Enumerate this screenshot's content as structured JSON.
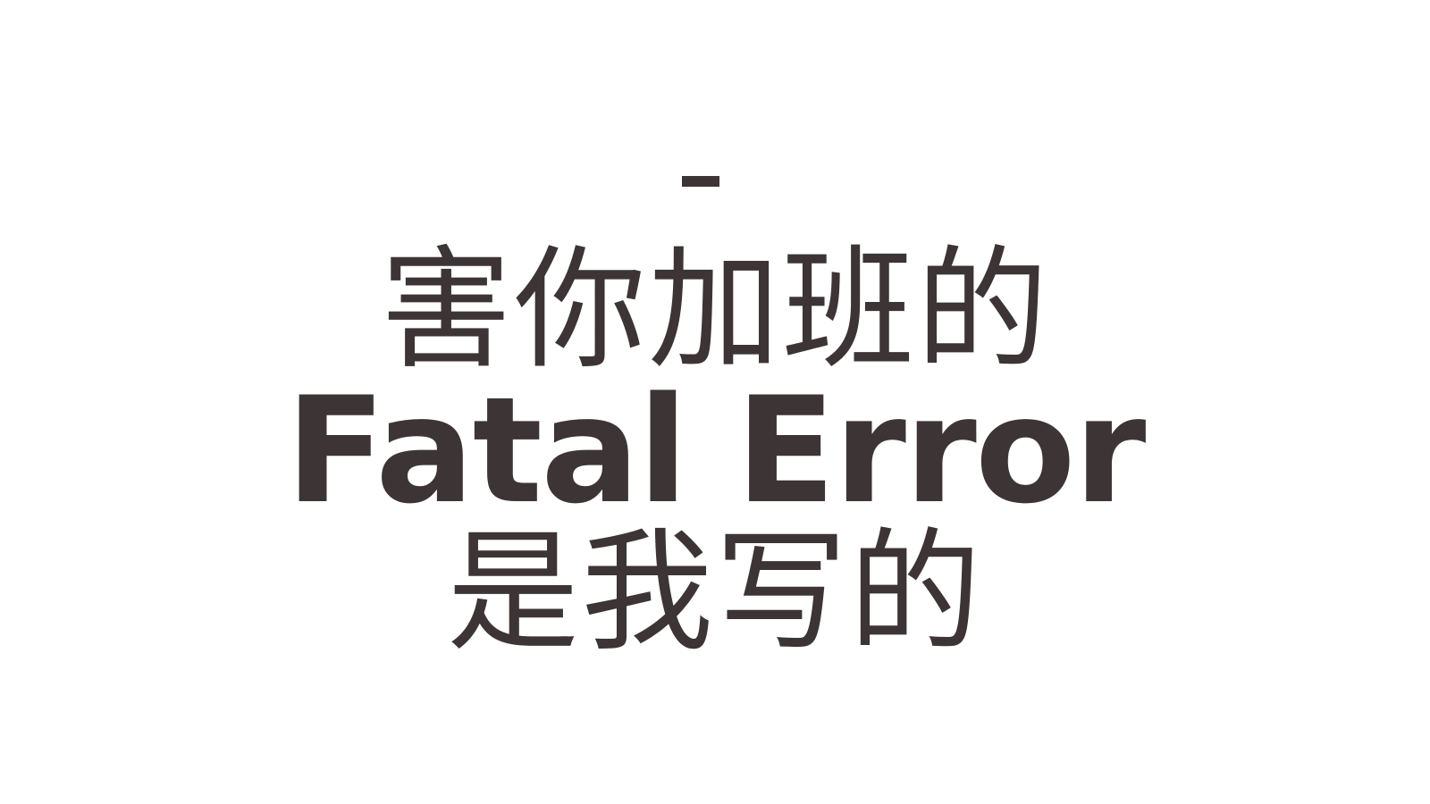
{
  "slide": {
    "dash": "-",
    "line1": "害你加班的",
    "line2": "Fatal Error",
    "line3": "是我写的",
    "text_color": "#3d3535",
    "background_color": "#ffffff"
  }
}
